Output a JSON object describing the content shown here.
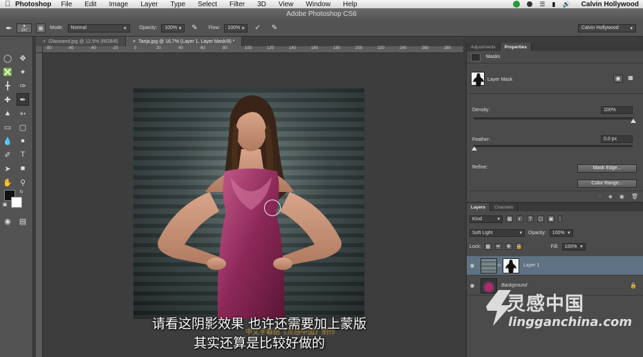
{
  "menubar": {
    "app_name": "Photoshop",
    "items": [
      "File",
      "Edit",
      "Image",
      "Layer",
      "Type",
      "Select",
      "Filter",
      "3D",
      "View",
      "Window",
      "Help"
    ],
    "user": "Calvin Hollywood"
  },
  "window": {
    "title": "Adobe Photoshop CS6"
  },
  "options_bar": {
    "brush_size": "237",
    "mode_label": "Mode:",
    "mode_value": "Normal",
    "opacity_label": "Opacity:",
    "opacity_value": "100%",
    "flow_label": "Flow:",
    "flow_value": "100%",
    "workspace": "Calvin Hollywood"
  },
  "doc_tabs": [
    {
      "label": "Glaswand.jpg @ 12,5% (RGB/8)",
      "active": false
    },
    {
      "label": "Tanja.jpg @ 16,7% (Layer 1, Layer Mask/8) *",
      "active": true
    }
  ],
  "ruler_ticks": [
    "-80",
    "-60",
    "-40",
    "-20",
    "0",
    "20",
    "40",
    "60",
    "80",
    "100",
    "120",
    "140",
    "160",
    "180",
    "200",
    "220",
    "240",
    "260",
    "280"
  ],
  "properties_panel": {
    "tabs": [
      "Adjustments",
      "Properties"
    ],
    "section": "Masks",
    "mask_name": "Layer Mask",
    "density_label": "Density:",
    "density_value": "100%",
    "density_level": 1.0,
    "feather_label": "Feather:",
    "feather_value": "0,0 px",
    "feather_level": 0.0,
    "refine_label": "Refine:",
    "mask_edge_button": "Mask Edge...",
    "color_range_button": "Color Range..."
  },
  "layers_panel": {
    "tabs": [
      "Layers",
      "Channels"
    ],
    "kind_filter": "Kind",
    "blend_mode": "Soft Light",
    "opacity_label": "Opacity:",
    "opacity_value": "100%",
    "lock_label": "Lock:",
    "fill_label": "Fill:",
    "fill_value": "100%",
    "layers": [
      {
        "name": "Layer 1",
        "selected": true
      },
      {
        "name": "Background",
        "selected": false
      }
    ]
  },
  "subtitles": {
    "line1": "请看这阴影效果  也许还需要加上蒙版",
    "line2": "其实还算是比较好做的"
  },
  "watermark": {
    "title": "灵感中国",
    "url": "lingganchina.com"
  },
  "colors": {
    "panel_bg": "#535353",
    "selected_layer": "#5f7284"
  }
}
